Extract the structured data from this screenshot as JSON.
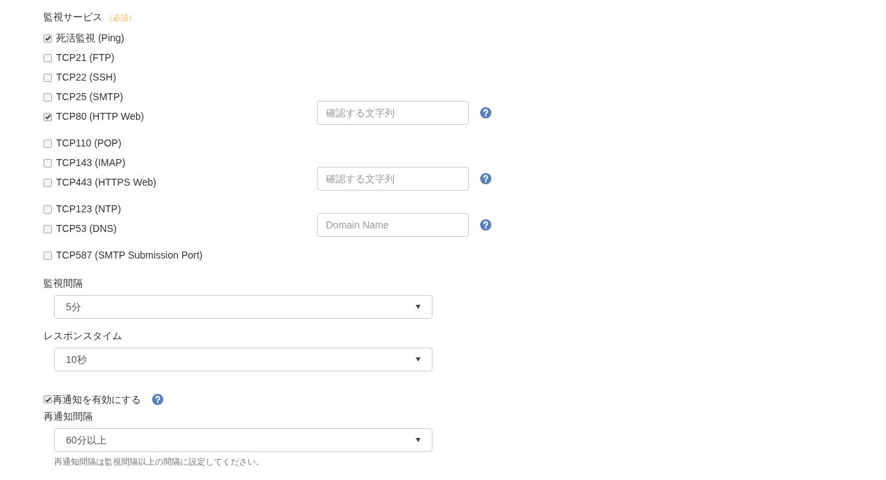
{
  "services": {
    "label": "監視サービス",
    "required": "（必須）",
    "items": [
      {
        "label": "死活監視 (Ping)",
        "checked": true
      },
      {
        "label": "TCP21 (FTP)",
        "checked": false
      },
      {
        "label": "TCP22 (SSH)",
        "checked": false
      },
      {
        "label": "TCP25 (SMTP)",
        "checked": false
      },
      {
        "label": "TCP80 (HTTP Web)",
        "checked": true,
        "field": {
          "placeholder": "確認する文字列"
        }
      },
      {
        "label": "TCP110 (POP)",
        "checked": false
      },
      {
        "label": "TCP143 (IMAP)",
        "checked": false
      },
      {
        "label": "TCP443 (HTTPS Web)",
        "checked": false,
        "field": {
          "placeholder": "確認する文字列"
        }
      },
      {
        "label": "TCP123 (NTP)",
        "checked": false
      },
      {
        "label": "TCP53 (DNS)",
        "checked": false,
        "field": {
          "placeholder": "Domain Name"
        }
      },
      {
        "label": "TCP587 (SMTP Submission Port)",
        "checked": false
      }
    ]
  },
  "interval": {
    "label": "監視間隔",
    "value": "5分"
  },
  "response_time": {
    "label": "レスポンスタイム",
    "value": "10秒"
  },
  "renotify": {
    "label": "再通知を有効にする",
    "checked": true
  },
  "renotify_interval": {
    "label": "再通知間隔",
    "value": "60分以上",
    "note": "再通知間隔は監視間隔以上の間隔に設定してください。"
  }
}
